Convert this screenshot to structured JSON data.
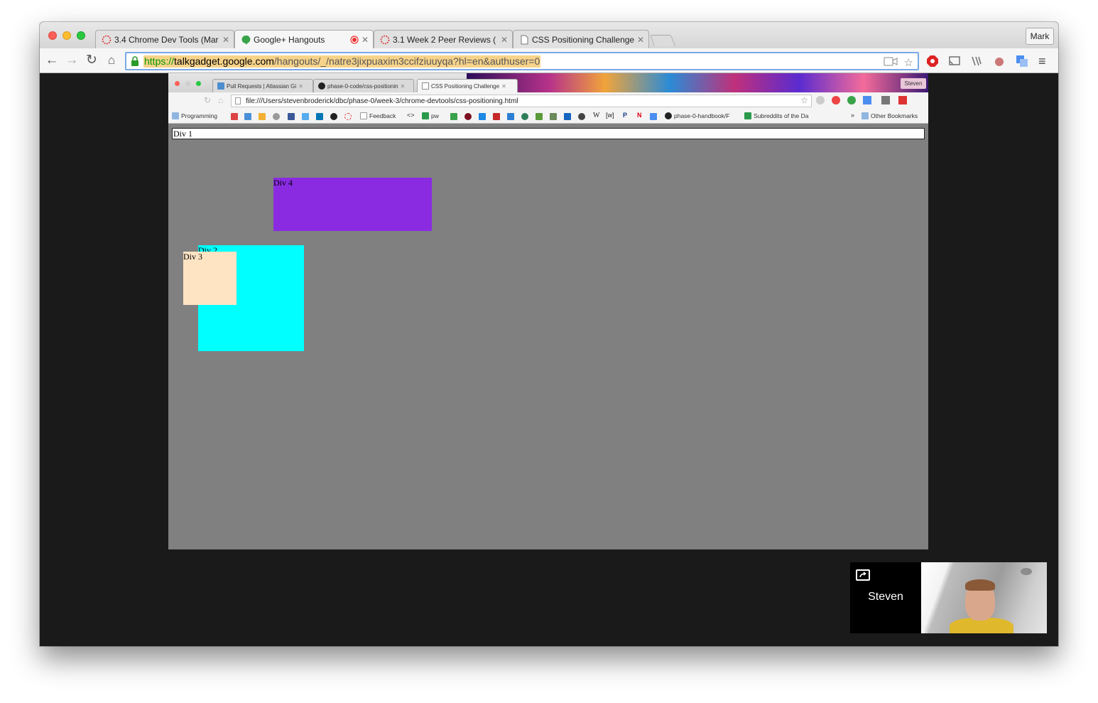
{
  "browser": {
    "tabs": [
      {
        "label": "3.4 Chrome Dev Tools (Mar",
        "icon": "dbc-icon"
      },
      {
        "label": "Google+ Hangouts",
        "icon": "hangouts-icon",
        "recording": true
      },
      {
        "label": "3.1 Week 2 Peer Reviews (",
        "icon": "dbc-icon"
      },
      {
        "label": "CSS Positioning Challenge",
        "icon": "document-icon"
      }
    ],
    "profile_label": "Mark",
    "url": {
      "proto": "https://",
      "host": "talkgadget.google.com",
      "path": "/hangouts/_/natre3jixpuaxim3ccifziuuyqa?hl=en&authuser=0"
    }
  },
  "shared_screen": {
    "tabs": [
      {
        "label": "Pull Requests | Atlassian Gi"
      },
      {
        "label": "phase-0-code/css-positionin"
      },
      {
        "label": "CSS Positioning Challenge"
      }
    ],
    "profile_label": "Steven",
    "url": "file:///Users/stevenbroderick/dbc/phase-0/week-3/chrome-devtools/css-positioning.html",
    "bookmarks": {
      "programming": "Programming",
      "feedback": "Feedback",
      "pw": "pw",
      "handbook": "phase-0-handbook/F",
      "subreddits": "Subreddits of the Da",
      "more": "»",
      "other": "Other Bookmarks"
    },
    "page": {
      "div1": "Div 1",
      "div2": "Div 2",
      "div3": "Div 3",
      "div4": "Div 4"
    },
    "colors": {
      "background": "#808080",
      "div1": "#ffffff",
      "div2": "#00ffff",
      "div3": "#ffe4c4",
      "div4": "#8a2be2"
    }
  },
  "hangout": {
    "participant_name": "Steven"
  }
}
